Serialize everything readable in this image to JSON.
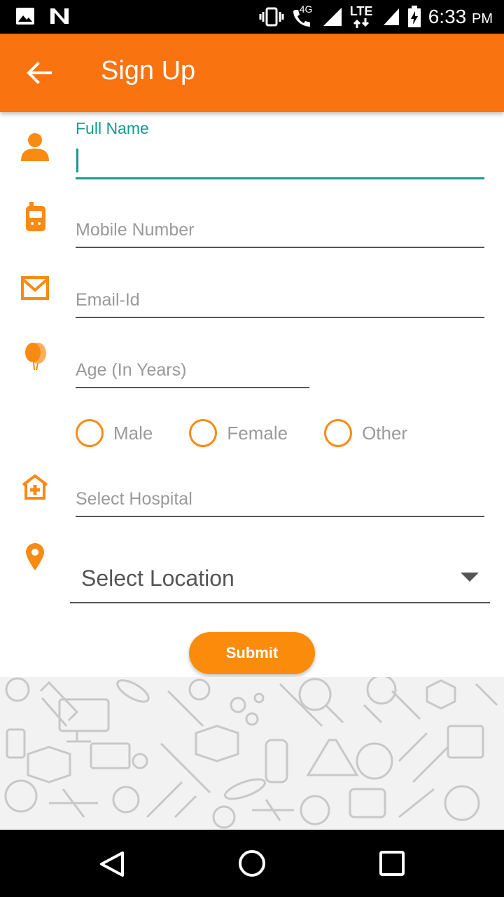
{
  "status_bar": {
    "network_label": "4G",
    "lte_label": "LTE",
    "time": "6:33",
    "ampm": "PM"
  },
  "app_bar": {
    "title": "Sign Up"
  },
  "form": {
    "full_name_label": "Full Name",
    "full_name_value": "",
    "mobile_placeholder": "Mobile Number",
    "email_placeholder": "Email-Id",
    "age_placeholder": "Age (In Years)",
    "gender_options": [
      "Male",
      "Female",
      "Other"
    ],
    "hospital_placeholder": "Select Hospital",
    "location_selected": "Select Location",
    "submit_label": "Submit"
  },
  "colors": {
    "accent": "#f97311",
    "icon": "#f98a12",
    "focus": "#119c8a"
  },
  "icons": {
    "full_name": "person-icon",
    "mobile": "mobile-phone-icon",
    "email": "envelope-icon",
    "age": "balloons-icon",
    "hospital": "hospital-icon",
    "location": "location-pin-icon"
  }
}
